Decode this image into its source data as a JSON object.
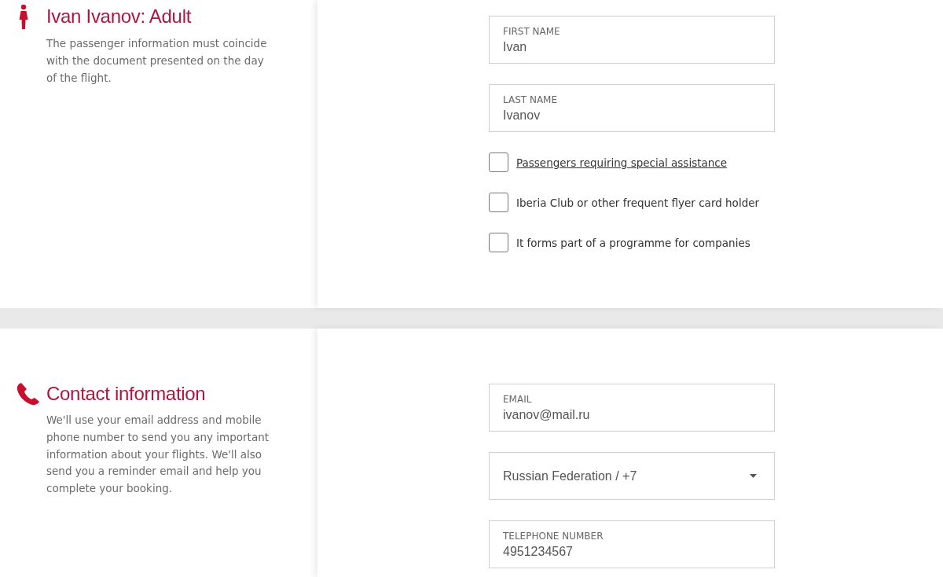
{
  "sections": [
    {
      "kind": "person",
      "title": "Ivan Ivanov: Adult",
      "description": "The passenger information must coincide with the document presented on the day of the flight.",
      "fields": [
        {
          "kind": "text",
          "label": "FIRST NAME",
          "value": "Ivan"
        },
        {
          "kind": "text",
          "label": "LAST NAME",
          "value": "Ivanov"
        }
      ],
      "options": [
        {
          "kind": "link",
          "label": "Passengers requiring special assistance",
          "checked": false
        },
        {
          "kind": "text",
          "label": "Iberia Club or other frequent flyer card holder",
          "checked": false
        },
        {
          "kind": "text",
          "label": "It forms part of a programme for companies",
          "checked": false
        }
      ]
    },
    {
      "kind": "phone",
      "title": "Contact information",
      "description": "We'll use your email address and mobile phone number to send you any important information about your flights. We'll also send you a reminder email and help you complete your booking.",
      "fields": [
        {
          "kind": "text",
          "label": "EMAIL",
          "value": "ivanov@mail.ru"
        },
        {
          "kind": "select",
          "value": "Russian Federation / +7"
        },
        {
          "kind": "text",
          "label": "TELEPHONE NUMBER",
          "value": "4951234567"
        }
      ]
    }
  ]
}
